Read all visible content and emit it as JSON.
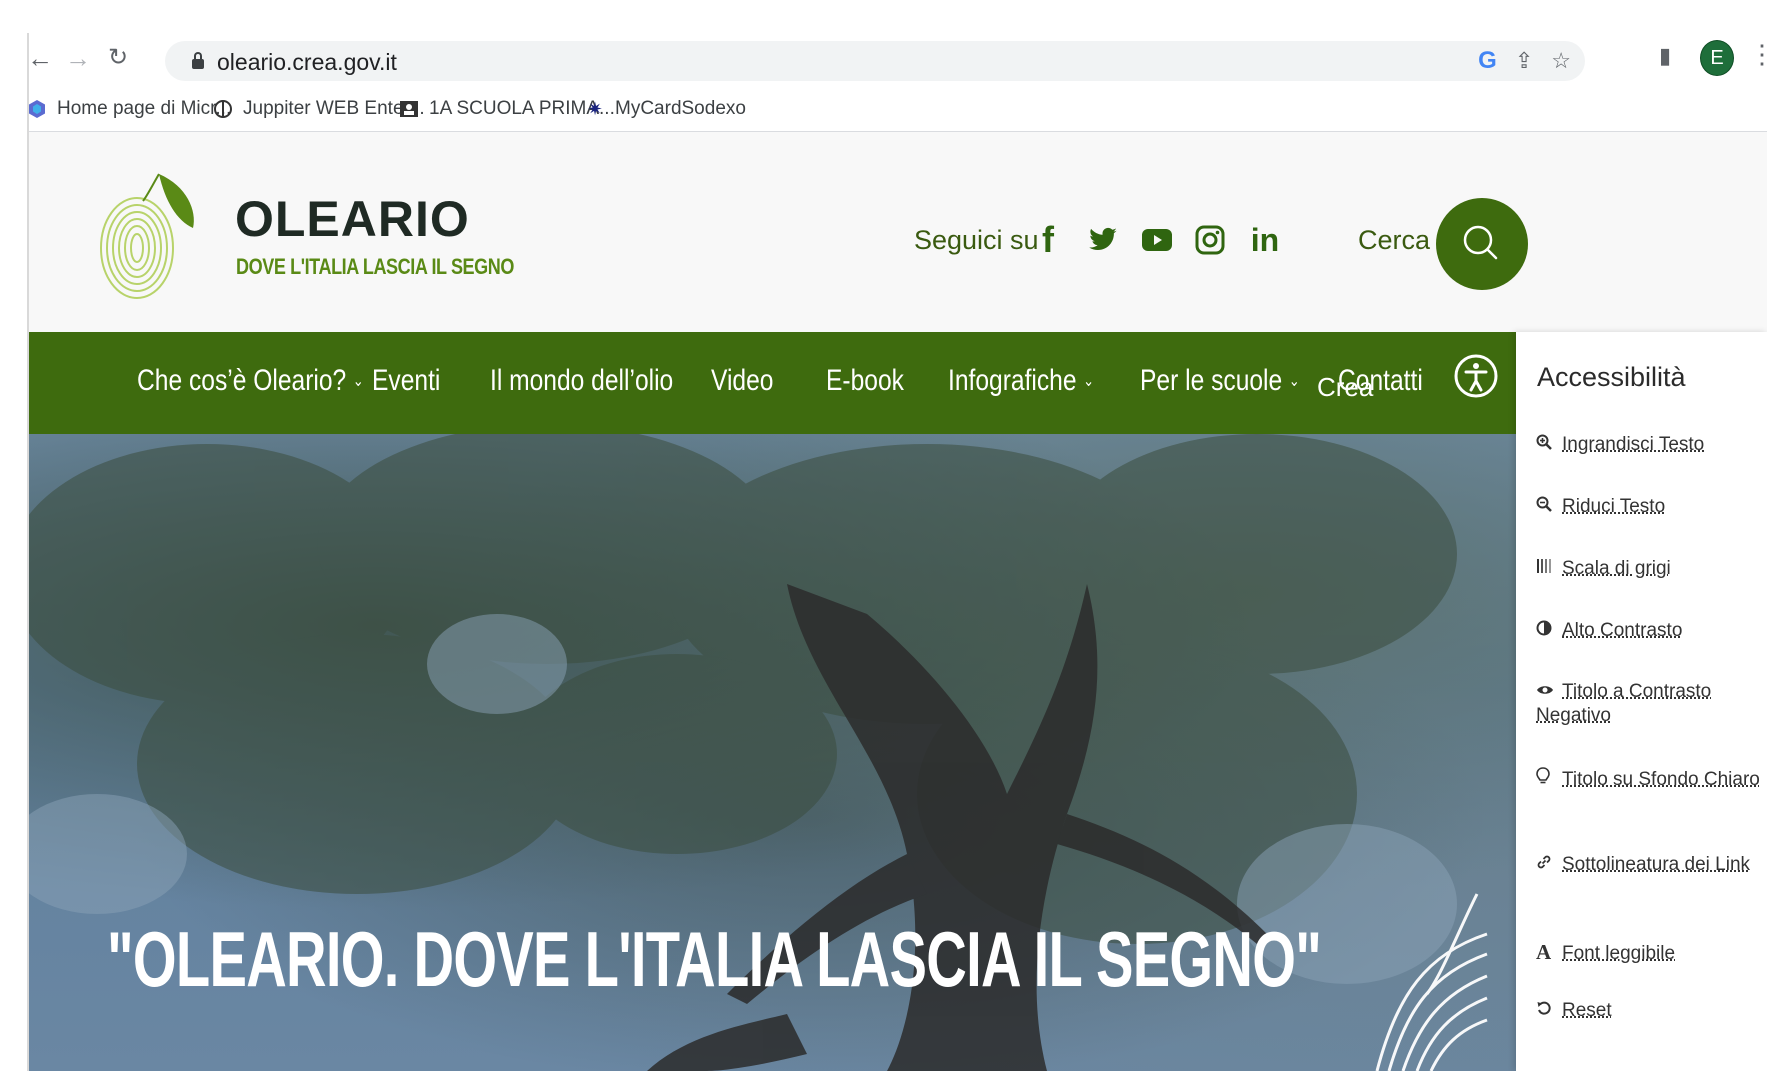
{
  "browser": {
    "url": "oleario.crea.gov.it",
    "profile_initial": "E",
    "bookmarks": [
      {
        "label": "Home page di Micr...",
        "icon": "microsoft-hexagon-icon"
      },
      {
        "label": "Juppiter WEB Enter...",
        "icon": "juppiter-logo-icon"
      },
      {
        "label": "1A SCUOLA PRIMA...",
        "icon": "classroom-icon"
      },
      {
        "label": "MyCardSodexo",
        "icon": "star-burst-icon"
      }
    ]
  },
  "header": {
    "brand_title": "OLEARIO",
    "brand_tagline": "DOVE L'ITALIA LASCIA IL SEGNO",
    "follow_label": "Seguici su",
    "social": [
      "facebook-icon",
      "twitter-icon",
      "youtube-icon",
      "instagram-icon",
      "linkedin-icon"
    ],
    "search_label": "Cerca"
  },
  "nav": {
    "items": [
      {
        "label": "Che cos’è Oleario?",
        "dropdown": true
      },
      {
        "label": "Eventi",
        "dropdown": false
      },
      {
        "label": "Il mondo dell’olio",
        "dropdown": false
      },
      {
        "label": "Video",
        "dropdown": false
      },
      {
        "label": "E-book",
        "dropdown": false
      },
      {
        "label": "Infografiche",
        "dropdown": true
      },
      {
        "label": "Per le scuole",
        "dropdown": true
      },
      {
        "label": "Contatti",
        "dropdown": false
      }
    ],
    "cut_off_label": "Crea"
  },
  "hero": {
    "title": "\"OLEARIO. DOVE L'ITALIA LASCIA IL SEGNO\""
  },
  "accessibility": {
    "title": "Accessibilità",
    "items": [
      {
        "label": "Ingrandisci Testo",
        "icon": "zoom-in-icon"
      },
      {
        "label": "Riduci Testo",
        "icon": "zoom-out-icon"
      },
      {
        "label": "Scala di grigi",
        "icon": "grayscale-bars-icon"
      },
      {
        "label": "Alto Contrasto",
        "icon": "contrast-icon"
      },
      {
        "label": "Titolo a Contrasto Negativo",
        "icon": "eye-icon"
      },
      {
        "label": "Titolo su Sfondo Chiaro",
        "icon": "lightbulb-icon"
      },
      {
        "label": "Sottolineatura dei Link",
        "icon": "link-icon"
      },
      {
        "label": "Font leggibile",
        "icon": "font-icon"
      },
      {
        "label": "Reset",
        "icon": "reset-icon"
      }
    ]
  },
  "colors": {
    "brand_green": "#3e6b0e",
    "leaf_green": "#5a8a16",
    "dark_text": "#1f2a24"
  }
}
